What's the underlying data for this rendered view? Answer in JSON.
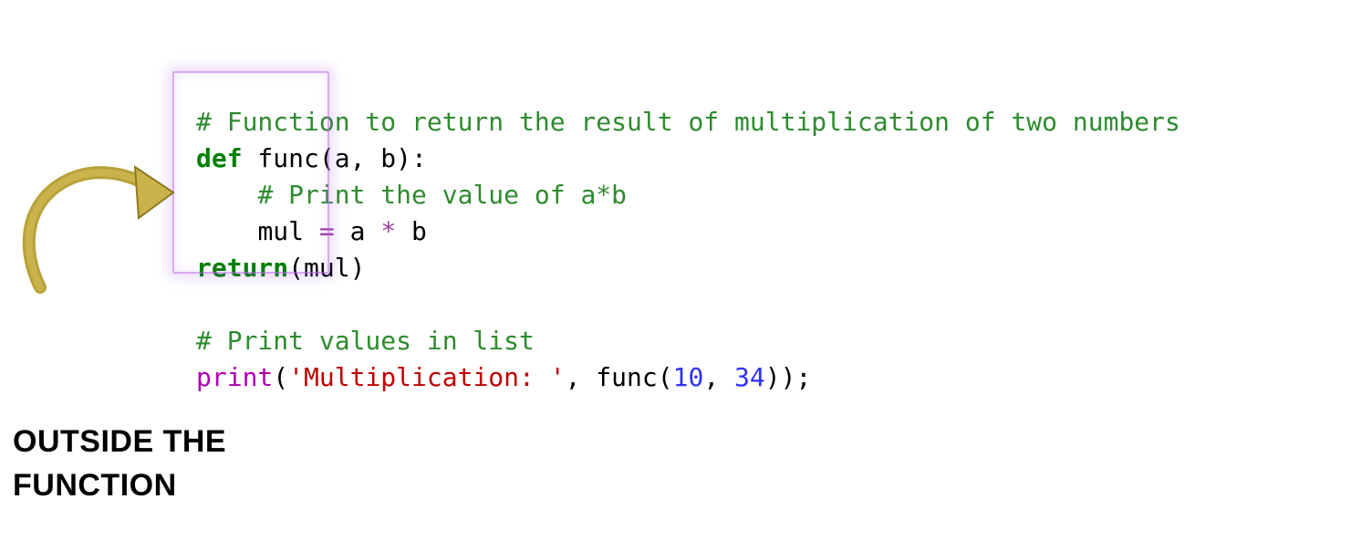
{
  "code": {
    "l1_comment": "# Function to return the result of multiplication of two numbers",
    "l2_def": "def",
    "l2_name": " func",
    "l2_params_open": "(",
    "l2_params": "a, b",
    "l2_params_close": "):",
    "l3_indent": "    ",
    "l3_comment": "# Print the value of a*b",
    "l4_indent": "    ",
    "l4_lhs": "mul ",
    "l4_eq": "=",
    "l4_sp1": " a ",
    "l4_star": "*",
    "l4_sp2": " b",
    "l5_return": "return",
    "l5_open": "(",
    "l5_arg": "mul",
    "l5_close": ")",
    "l7_comment": "# Print values in list",
    "l8_print": "print",
    "l8_open": "(",
    "l8_str": "'Multiplication: '",
    "l8_comma": ", func(",
    "l8_n1": "10",
    "l8_sep": ", ",
    "l8_n2": "34",
    "l8_close": "));"
  },
  "annotation": {
    "text": "OUTSIDE THE\nFUNCTION"
  }
}
